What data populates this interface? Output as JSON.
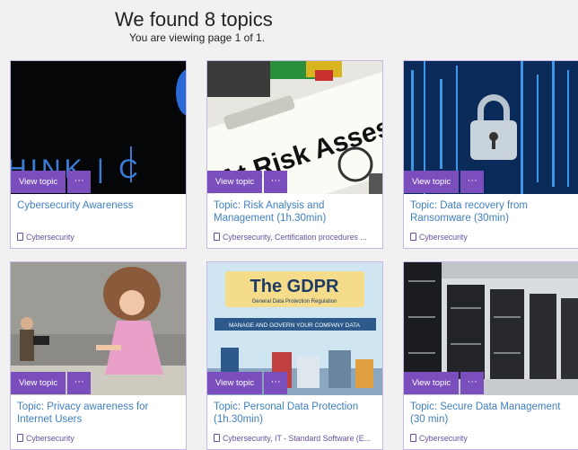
{
  "header": {
    "title": "We found 8 topics",
    "subtitle": "You are viewing page 1 of 1."
  },
  "cards": [
    {
      "title": "Cybersecurity Awareness",
      "tags": "Cybersecurity",
      "image_text": "HINK  |  C",
      "view_label": "View topic",
      "more_label": "···"
    },
    {
      "title": "Topic: Risk Analysis and Management (1h.30min)",
      "tags": "Cybersecurity, Certification procedures ...",
      "image_text": "At Risk Assessment",
      "view_label": "View topic",
      "more_label": "···"
    },
    {
      "title": "Topic: Data recovery from Ransomware (30min)",
      "tags": "Cybersecurity",
      "view_label": "View topic",
      "more_label": "···"
    },
    {
      "title": "Topic: Privacy awareness for Internet Users",
      "tags": "Cybersecurity",
      "view_label": "View topic",
      "more_label": "···"
    },
    {
      "title": "Topic: Personal Data Protection (1h.30min)",
      "tags": "Cybersecurity, IT - Standard Software (E...",
      "image_text": "The GDPR",
      "image_subtext": "General Data Protection Regulation",
      "image_banner": "MANAGE AND GOVERN YOUR COMPANY DATA",
      "view_label": "View topic",
      "more_label": "···"
    },
    {
      "title": "Topic: Secure Data Management (30 min)",
      "tags": "Cybersecurity",
      "view_label": "View topic",
      "more_label": "···"
    }
  ],
  "colors": {
    "accent": "#7a4fbd",
    "link": "#3f7fbf",
    "tag": "#6a4fa0",
    "border": "#c9b7e3"
  }
}
